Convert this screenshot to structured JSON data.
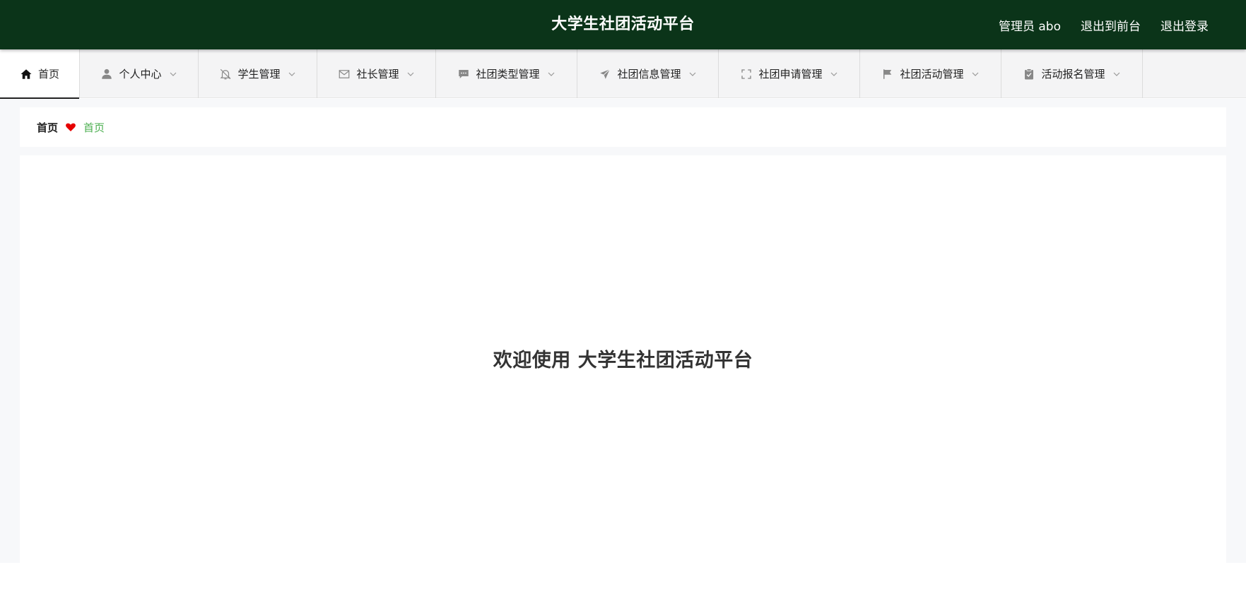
{
  "header": {
    "title": "大学生社团活动平台",
    "user_label": "管理员 abo",
    "back_to_front": "退出到前台",
    "logout": "退出登录",
    "background_color": "#0b3419"
  },
  "nav": {
    "items": [
      {
        "label": "首页",
        "icon": "home-icon",
        "active": true,
        "dropdown": false
      },
      {
        "label": "个人中心",
        "icon": "user-icon",
        "active": false,
        "dropdown": true
      },
      {
        "label": "学生管理",
        "icon": "bell-off-icon",
        "active": false,
        "dropdown": true
      },
      {
        "label": "社长管理",
        "icon": "mail-icon",
        "active": false,
        "dropdown": true
      },
      {
        "label": "社团类型管理",
        "icon": "chat-icon",
        "active": false,
        "dropdown": true
      },
      {
        "label": "社团信息管理",
        "icon": "send-icon",
        "active": false,
        "dropdown": true
      },
      {
        "label": "社团申请管理",
        "icon": "fullscreen-icon",
        "active": false,
        "dropdown": true
      },
      {
        "label": "社团活动管理",
        "icon": "flag-icon",
        "active": false,
        "dropdown": true
      },
      {
        "label": "活动报名管理",
        "icon": "clipboard-check-icon",
        "active": false,
        "dropdown": true
      }
    ]
  },
  "breadcrumb": {
    "root": "首页",
    "separator_icon": "heart-icon",
    "separator_color": "#e60000",
    "current": "首页",
    "current_color": "#4caf50"
  },
  "content": {
    "welcome": "欢迎使用 大学生社团活动平台"
  }
}
